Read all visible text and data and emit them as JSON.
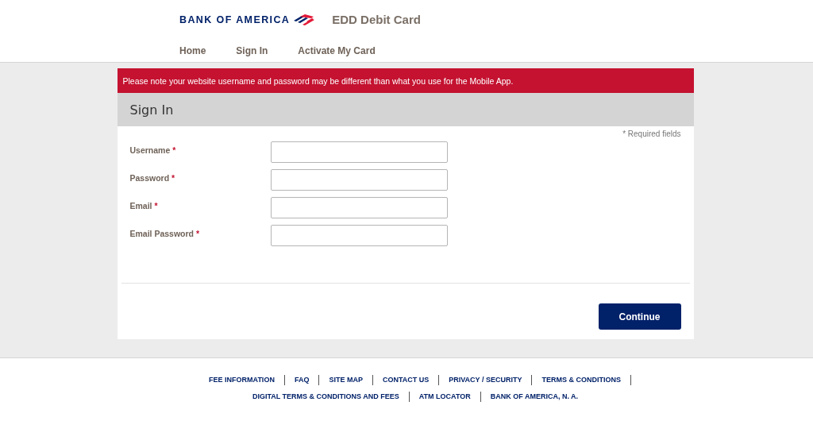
{
  "header": {
    "logo_text": "BANK OF AMERICA",
    "product": "EDD Debit Card"
  },
  "nav": [
    "Home",
    "Sign In",
    "Activate My Card"
  ],
  "notice": "Please note your website username and password may be different than what you use for the Mobile App.",
  "sign_in": {
    "title": "Sign In",
    "required_note": "* Required fields",
    "fields": [
      {
        "label": "Username",
        "mark": "*"
      },
      {
        "label": "Password",
        "mark": "*"
      },
      {
        "label": "Email",
        "mark": "*"
      },
      {
        "label": "Email Password",
        "mark": "*"
      }
    ],
    "button": "Continue"
  },
  "footer": {
    "links": [
      "FEE INFORMATION",
      "FAQ",
      "SITE MAP",
      "CONTACT US",
      "PRIVACY / SECURITY",
      "TERMS & CONDITIONS",
      "DIGITAL TERMS & CONDITIONS AND FEES",
      "ATM LOCATOR",
      "BANK OF AMERICA, N. A."
    ]
  }
}
